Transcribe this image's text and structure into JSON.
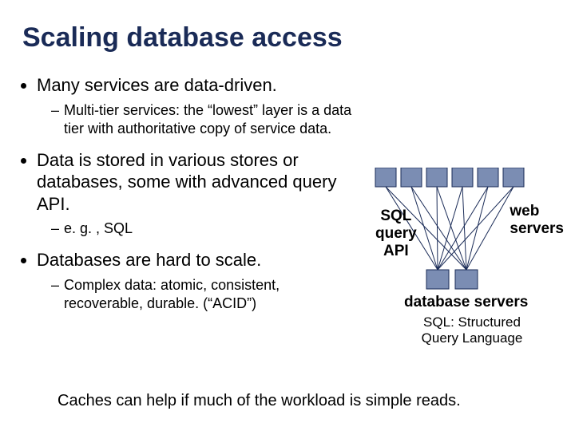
{
  "title": "Scaling database access",
  "bullets": {
    "b1": "Many services are data-driven.",
    "b1s1": "Multi-tier services: the “lowest” layer is a data tier with authoritative copy of service data.",
    "b2": "Data is stored in various stores or databases, some with advanced query API.",
    "b2s1": "e. g. , SQL",
    "b3": "Databases are hard to scale.",
    "b3s1": "Complex data: atomic, consistent, recoverable, durable.  (“ACID”)"
  },
  "diagram": {
    "sql_label_l1": "SQL",
    "sql_label_l2": "query",
    "sql_label_l3": "API",
    "web_label_l1": "web",
    "web_label_l2": "servers",
    "db_label": "database servers",
    "acr_l1": "SQL: Structured",
    "acr_l2": "Query Language"
  },
  "footer": "Caches can help if much of the workload is simple reads."
}
